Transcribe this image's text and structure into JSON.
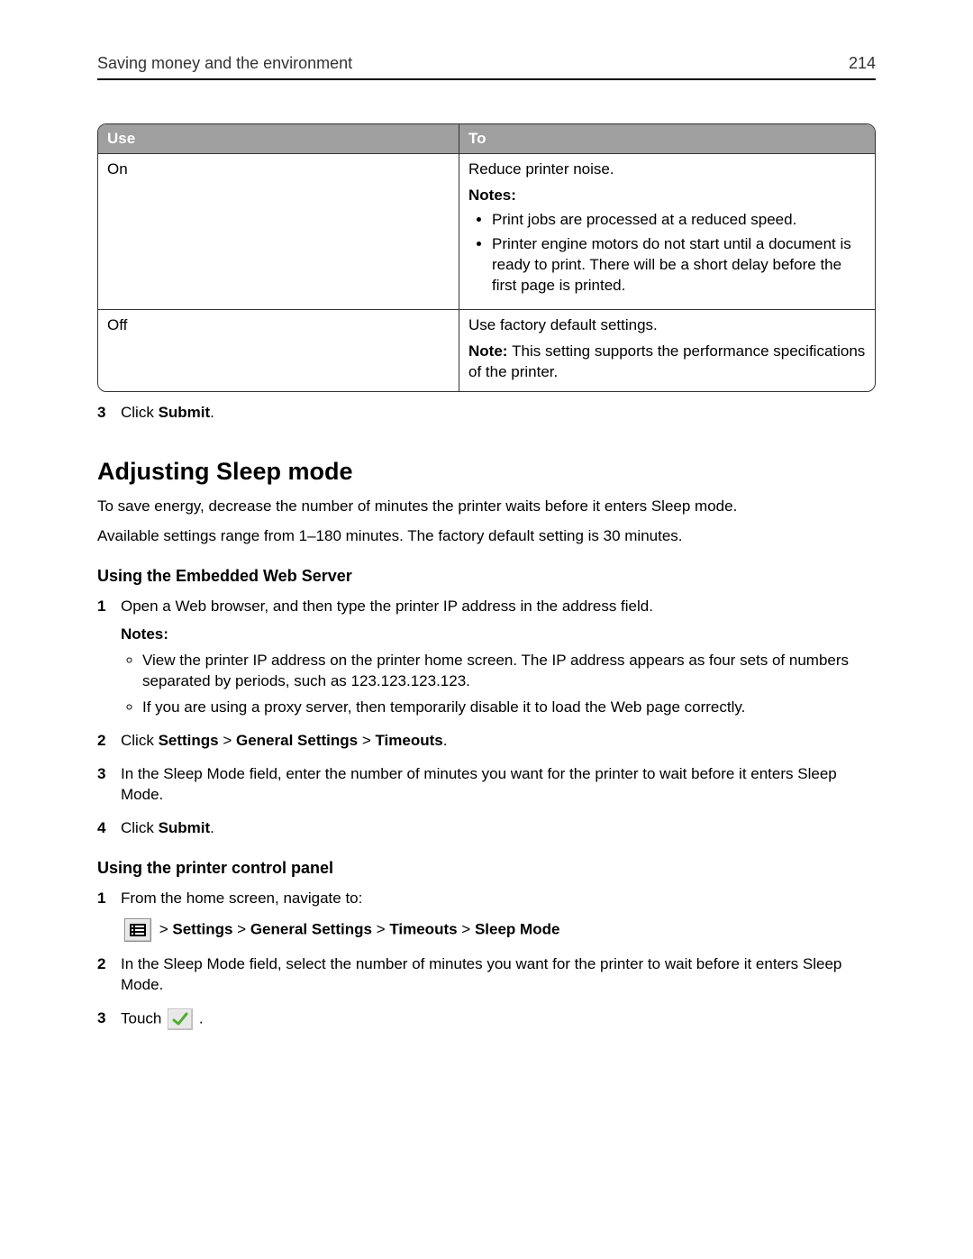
{
  "runhead": {
    "title": "Saving money and the environment",
    "page": "214"
  },
  "table": {
    "header": {
      "use": "Use",
      "to": "To"
    },
    "rows": [
      {
        "use": "On",
        "to_lead": "Reduce printer noise.",
        "notes_label": "Notes:",
        "bullets": [
          "Print jobs are processed at a reduced speed.",
          "Printer engine motors do not start until a document is ready to print. There will be a short delay before the first page is printed."
        ]
      },
      {
        "use": "Off",
        "to_lead": "Use factory default settings.",
        "note_prefix": "Note: ",
        "note_rest": "This setting supports the performance specifications of the printer."
      }
    ]
  },
  "step_click": "Click ",
  "submit": "Submit",
  "period": ".",
  "heading2": "Adjusting Sleep mode",
  "para1": "To save energy, decrease the number of minutes the printer waits before it enters Sleep mode.",
  "para2": "Available settings range from 1–180 minutes. The factory default setting is 30 minutes.",
  "h3_ews": "Using the Embedded Web Server",
  "ews": {
    "s1": "Open a Web browser, and then type the printer IP address in the address field.",
    "notes_label": "Notes:",
    "bullets": [
      "View the printer IP address on the printer home screen. The IP address appears as four sets of numbers separated by periods, such as 123.123.123.123.",
      "If you are using a proxy server, then temporarily disable it to load the Web page correctly."
    ],
    "s2_prefix": "Click ",
    "s2_path1": "Settings",
    "gt": " > ",
    "s2_path2": "General Settings",
    "s2_path3": "Timeouts",
    "s3": "In the Sleep Mode field, enter the number of minutes you want for the printer to wait before it enters Sleep Mode."
  },
  "h3_panel": "Using the printer control panel",
  "panel": {
    "s1": "From the home screen, navigate to:",
    "nav_gt": " > ",
    "nav1": "Settings",
    "nav2": "General Settings",
    "nav3": "Timeouts",
    "nav4": "Sleep Mode",
    "s2": "In the Sleep Mode field, select the number of minutes you want for the printer to wait before it enters Sleep Mode.",
    "s3_prefix": "Touch "
  }
}
